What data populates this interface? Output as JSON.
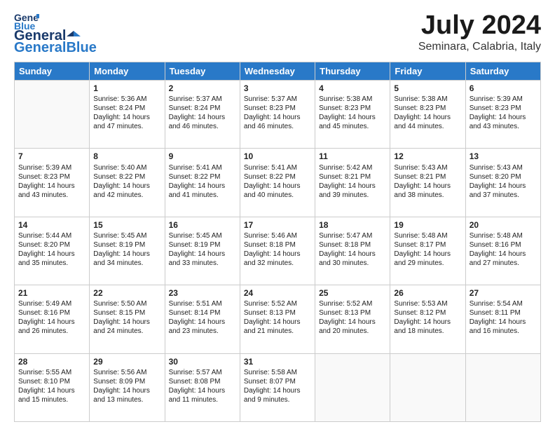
{
  "header": {
    "logo": "GeneralBlue",
    "title": "July 2024",
    "subtitle": "Seminara, Calabria, Italy"
  },
  "days_of_week": [
    "Sunday",
    "Monday",
    "Tuesday",
    "Wednesday",
    "Thursday",
    "Friday",
    "Saturday"
  ],
  "weeks": [
    [
      {
        "num": "",
        "info": ""
      },
      {
        "num": "1",
        "info": "Sunrise: 5:36 AM\nSunset: 8:24 PM\nDaylight: 14 hours\nand 47 minutes."
      },
      {
        "num": "2",
        "info": "Sunrise: 5:37 AM\nSunset: 8:24 PM\nDaylight: 14 hours\nand 46 minutes."
      },
      {
        "num": "3",
        "info": "Sunrise: 5:37 AM\nSunset: 8:23 PM\nDaylight: 14 hours\nand 46 minutes."
      },
      {
        "num": "4",
        "info": "Sunrise: 5:38 AM\nSunset: 8:23 PM\nDaylight: 14 hours\nand 45 minutes."
      },
      {
        "num": "5",
        "info": "Sunrise: 5:38 AM\nSunset: 8:23 PM\nDaylight: 14 hours\nand 44 minutes."
      },
      {
        "num": "6",
        "info": "Sunrise: 5:39 AM\nSunset: 8:23 PM\nDaylight: 14 hours\nand 43 minutes."
      }
    ],
    [
      {
        "num": "7",
        "info": "Sunrise: 5:39 AM\nSunset: 8:23 PM\nDaylight: 14 hours\nand 43 minutes."
      },
      {
        "num": "8",
        "info": "Sunrise: 5:40 AM\nSunset: 8:22 PM\nDaylight: 14 hours\nand 42 minutes."
      },
      {
        "num": "9",
        "info": "Sunrise: 5:41 AM\nSunset: 8:22 PM\nDaylight: 14 hours\nand 41 minutes."
      },
      {
        "num": "10",
        "info": "Sunrise: 5:41 AM\nSunset: 8:22 PM\nDaylight: 14 hours\nand 40 minutes."
      },
      {
        "num": "11",
        "info": "Sunrise: 5:42 AM\nSunset: 8:21 PM\nDaylight: 14 hours\nand 39 minutes."
      },
      {
        "num": "12",
        "info": "Sunrise: 5:43 AM\nSunset: 8:21 PM\nDaylight: 14 hours\nand 38 minutes."
      },
      {
        "num": "13",
        "info": "Sunrise: 5:43 AM\nSunset: 8:20 PM\nDaylight: 14 hours\nand 37 minutes."
      }
    ],
    [
      {
        "num": "14",
        "info": "Sunrise: 5:44 AM\nSunset: 8:20 PM\nDaylight: 14 hours\nand 35 minutes."
      },
      {
        "num": "15",
        "info": "Sunrise: 5:45 AM\nSunset: 8:19 PM\nDaylight: 14 hours\nand 34 minutes."
      },
      {
        "num": "16",
        "info": "Sunrise: 5:45 AM\nSunset: 8:19 PM\nDaylight: 14 hours\nand 33 minutes."
      },
      {
        "num": "17",
        "info": "Sunrise: 5:46 AM\nSunset: 8:18 PM\nDaylight: 14 hours\nand 32 minutes."
      },
      {
        "num": "18",
        "info": "Sunrise: 5:47 AM\nSunset: 8:18 PM\nDaylight: 14 hours\nand 30 minutes."
      },
      {
        "num": "19",
        "info": "Sunrise: 5:48 AM\nSunset: 8:17 PM\nDaylight: 14 hours\nand 29 minutes."
      },
      {
        "num": "20",
        "info": "Sunrise: 5:48 AM\nSunset: 8:16 PM\nDaylight: 14 hours\nand 27 minutes."
      }
    ],
    [
      {
        "num": "21",
        "info": "Sunrise: 5:49 AM\nSunset: 8:16 PM\nDaylight: 14 hours\nand 26 minutes."
      },
      {
        "num": "22",
        "info": "Sunrise: 5:50 AM\nSunset: 8:15 PM\nDaylight: 14 hours\nand 24 minutes."
      },
      {
        "num": "23",
        "info": "Sunrise: 5:51 AM\nSunset: 8:14 PM\nDaylight: 14 hours\nand 23 minutes."
      },
      {
        "num": "24",
        "info": "Sunrise: 5:52 AM\nSunset: 8:13 PM\nDaylight: 14 hours\nand 21 minutes."
      },
      {
        "num": "25",
        "info": "Sunrise: 5:52 AM\nSunset: 8:13 PM\nDaylight: 14 hours\nand 20 minutes."
      },
      {
        "num": "26",
        "info": "Sunrise: 5:53 AM\nSunset: 8:12 PM\nDaylight: 14 hours\nand 18 minutes."
      },
      {
        "num": "27",
        "info": "Sunrise: 5:54 AM\nSunset: 8:11 PM\nDaylight: 14 hours\nand 16 minutes."
      }
    ],
    [
      {
        "num": "28",
        "info": "Sunrise: 5:55 AM\nSunset: 8:10 PM\nDaylight: 14 hours\nand 15 minutes."
      },
      {
        "num": "29",
        "info": "Sunrise: 5:56 AM\nSunset: 8:09 PM\nDaylight: 14 hours\nand 13 minutes."
      },
      {
        "num": "30",
        "info": "Sunrise: 5:57 AM\nSunset: 8:08 PM\nDaylight: 14 hours\nand 11 minutes."
      },
      {
        "num": "31",
        "info": "Sunrise: 5:58 AM\nSunset: 8:07 PM\nDaylight: 14 hours\nand 9 minutes."
      },
      {
        "num": "",
        "info": ""
      },
      {
        "num": "",
        "info": ""
      },
      {
        "num": "",
        "info": ""
      }
    ]
  ]
}
